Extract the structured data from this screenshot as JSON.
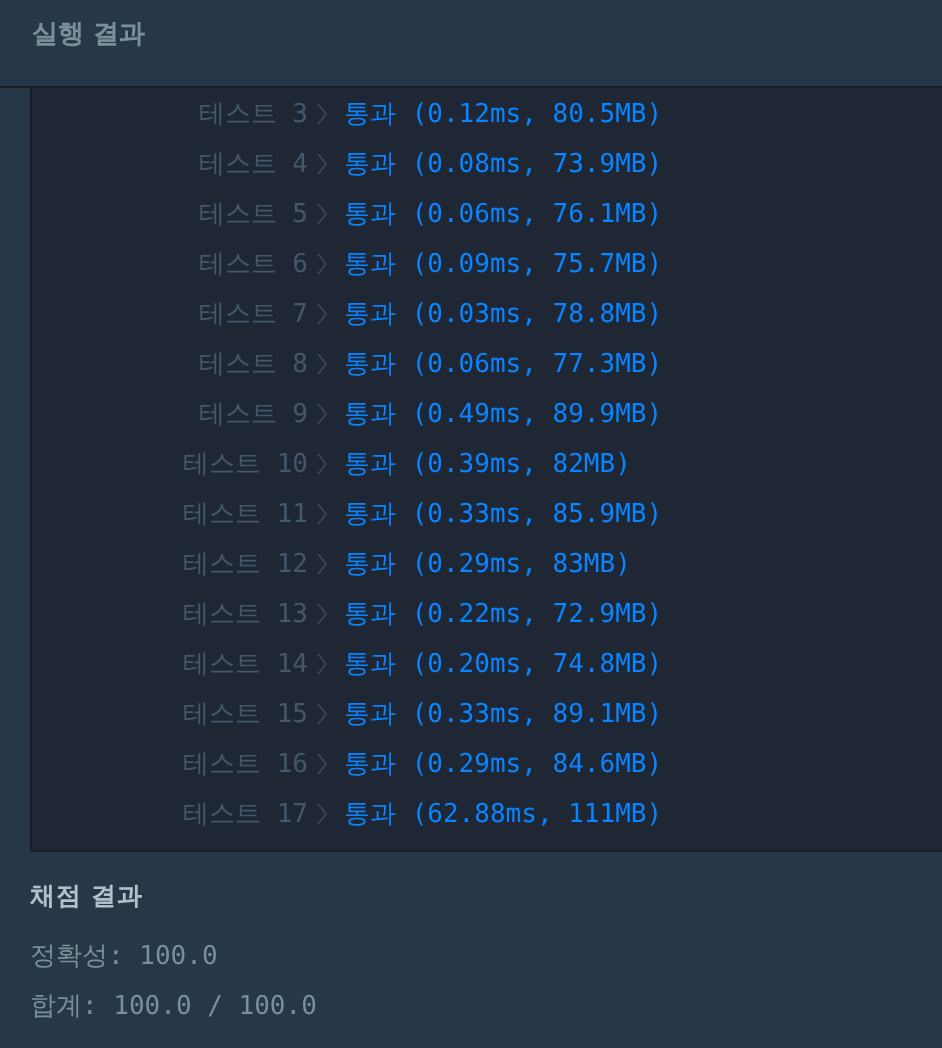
{
  "header": {
    "title": "실행 결과"
  },
  "tests": [
    {
      "label": "테스트 3",
      "kind": "pass",
      "result": "통과 (0.12ms, 80.5MB)"
    },
    {
      "label": "테스트 4",
      "kind": "pass",
      "result": "통과 (0.08ms, 73.9MB)"
    },
    {
      "label": "테스트 5",
      "kind": "pass",
      "result": "통과 (0.06ms, 76.1MB)"
    },
    {
      "label": "테스트 6",
      "kind": "pass",
      "result": "통과 (0.09ms, 75.7MB)"
    },
    {
      "label": "테스트 7",
      "kind": "pass",
      "result": "통과 (0.03ms, 78.8MB)"
    },
    {
      "label": "테스트 8",
      "kind": "pass",
      "result": "통과 (0.06ms, 77.3MB)"
    },
    {
      "label": "테스트 9",
      "kind": "pass",
      "result": "통과 (0.49ms, 89.9MB)"
    },
    {
      "label": "테스트 10",
      "kind": "pass",
      "result": "통과 (0.39ms, 82MB)"
    },
    {
      "label": "테스트 11",
      "kind": "pass",
      "result": "통과 (0.33ms, 85.9MB)"
    },
    {
      "label": "테스트 12",
      "kind": "pass",
      "result": "통과 (0.29ms, 83MB)"
    },
    {
      "label": "테스트 13",
      "kind": "pass",
      "result": "통과 (0.22ms, 72.9MB)"
    },
    {
      "label": "테스트 14",
      "kind": "pass",
      "result": "통과 (0.20ms, 74.8MB)"
    },
    {
      "label": "테스트 15",
      "kind": "pass",
      "result": "통과 (0.33ms, 89.1MB)"
    },
    {
      "label": "테스트 16",
      "kind": "pass",
      "result": "통과 (0.29ms, 84.6MB)"
    },
    {
      "label": "테스트 17",
      "kind": "pass",
      "result": "통과 (62.88ms, 111MB)"
    }
  ],
  "grading": {
    "title": "채점 결과",
    "lines": [
      "정확성: 100.0",
      "합계: 100.0 / 100.0"
    ]
  }
}
